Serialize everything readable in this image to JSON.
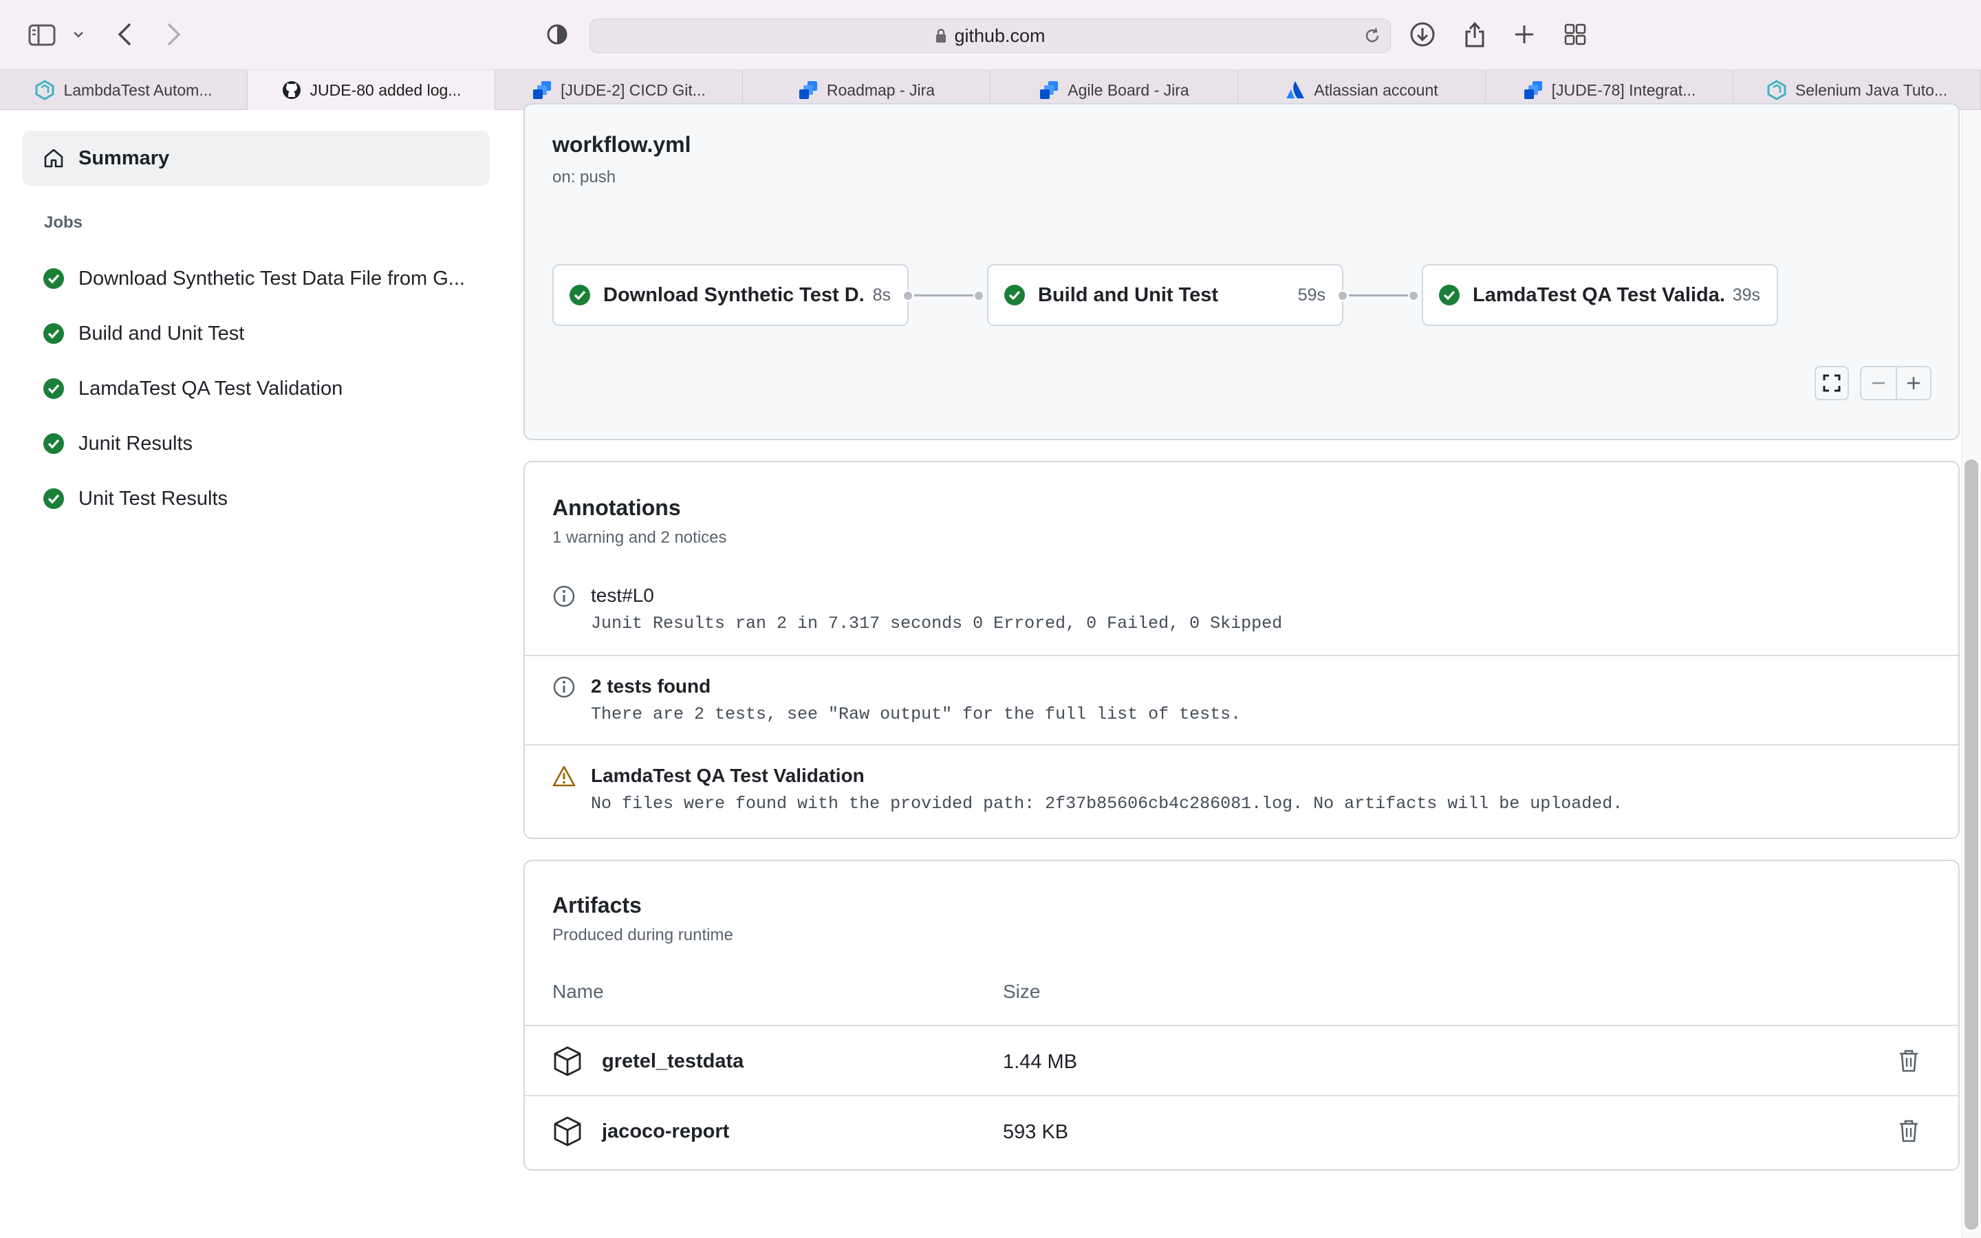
{
  "browser": {
    "url": "github.com",
    "tabs": [
      {
        "label": "LambdaTest Autom...",
        "favicon": "lambdatest-icon"
      },
      {
        "label": "JUDE-80 added log...",
        "favicon": "github-icon",
        "active": true
      },
      {
        "label": "[JUDE-2] CICD Git...",
        "favicon": "jira-icon"
      },
      {
        "label": "Roadmap - Jira",
        "favicon": "jira-icon"
      },
      {
        "label": "Agile Board - Jira",
        "favicon": "jira-icon"
      },
      {
        "label": "Atlassian account",
        "favicon": "atlassian-icon"
      },
      {
        "label": "[JUDE-78] Integrat...",
        "favicon": "jira-icon"
      },
      {
        "label": "Selenium Java Tuto...",
        "favicon": "lambdatest-icon"
      }
    ]
  },
  "sidebar": {
    "summary_label": "Summary",
    "jobs_heading": "Jobs",
    "jobs": [
      {
        "label": "Download Synthetic Test Data File from G...",
        "status": "success"
      },
      {
        "label": "Build and Unit Test",
        "status": "success"
      },
      {
        "label": "LamdaTest QA Test Validation",
        "status": "success"
      },
      {
        "label": "Junit Results",
        "status": "success"
      },
      {
        "label": "Unit Test Results",
        "status": "success"
      }
    ]
  },
  "workflow": {
    "title": "workflow.yml",
    "trigger": "on: push",
    "nodes": [
      {
        "label": "Download Synthetic Test D...",
        "duration": "8s"
      },
      {
        "label": "Build and Unit Test",
        "duration": "59s"
      },
      {
        "label": "LamdaTest QA Test Valida...",
        "duration": "39s"
      }
    ]
  },
  "annotations": {
    "title": "Annotations",
    "subtitle": "1 warning and 2 notices",
    "items": [
      {
        "kind": "notice",
        "title": "test#L0",
        "message": "Junit Results ran 2 in 7.317 seconds 0 Errored, 0 Failed, 0 Skipped"
      },
      {
        "kind": "notice",
        "title": "2 tests found",
        "message": "There are 2 tests, see \"Raw output\" for the full list of tests."
      },
      {
        "kind": "warning",
        "title": "LamdaTest QA Test Validation",
        "message": "No files were found with the provided path: 2f37b85606cb4c286081.log. No artifacts will be uploaded."
      }
    ]
  },
  "artifacts": {
    "title": "Artifacts",
    "subtitle": "Produced during runtime",
    "col_name": "Name",
    "col_size": "Size",
    "rows": [
      {
        "name": "gretel_testdata",
        "size": "1.44 MB"
      },
      {
        "name": "jacoco-report",
        "size": "593 KB"
      }
    ]
  },
  "colors": {
    "success": "#1a7f37",
    "warning": "#9a6700",
    "border": "#d1d9e0",
    "muted": "#59636e"
  }
}
